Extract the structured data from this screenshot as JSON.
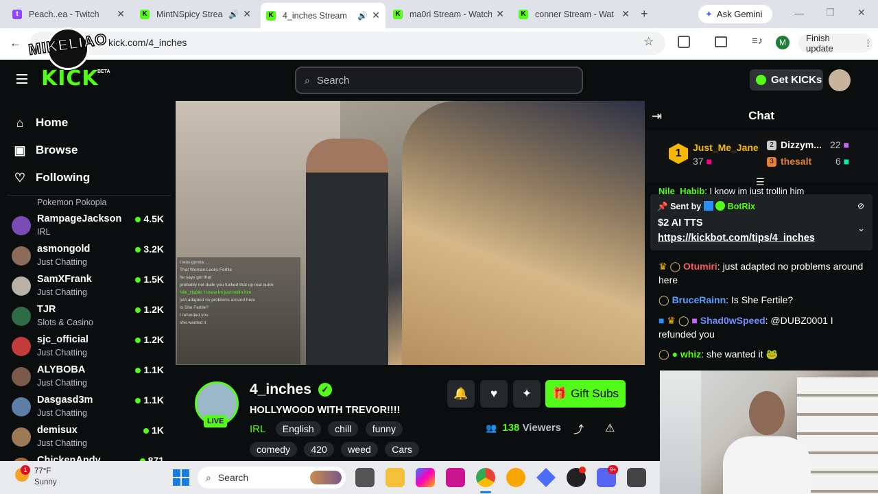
{
  "browser": {
    "tabs": [
      {
        "title": "Peach..ea - Twitch",
        "favicon": "twitch"
      },
      {
        "title": "MintNSpicy Strea",
        "favicon": "kick"
      },
      {
        "title": "4_inches Stream",
        "favicon": "kick"
      },
      {
        "title": "ma0ri Stream - Watch",
        "favicon": "kick"
      },
      {
        "title": "conner Stream - Wat",
        "favicon": "kick"
      }
    ],
    "ask_gemini": "Ask Gemini",
    "url": "kick.com/4_inches",
    "finish_update": "Finish update",
    "profile_initial": "M",
    "overlay_logo": "MIKELIAO"
  },
  "kick": {
    "logo": "KICK",
    "beta": "BETA",
    "search_placeholder": "Search",
    "get_kicks": "Get KICKs",
    "nav": [
      {
        "label": "Home",
        "icon": "home-icon"
      },
      {
        "label": "Browse",
        "icon": "browse-icon"
      },
      {
        "label": "Following",
        "icon": "heart-icon"
      }
    ],
    "cut_item": "Pokemon Pokopia",
    "channels": [
      {
        "name": "RampageJackson",
        "category": "IRL",
        "viewers": "4.5K",
        "color": "#7a4bb5"
      },
      {
        "name": "asmongold",
        "category": "Just Chatting",
        "viewers": "3.2K",
        "color": "#8c6b58"
      },
      {
        "name": "SamXFrank",
        "category": "Just Chatting",
        "viewers": "1.5K",
        "color": "#b9b1a8"
      },
      {
        "name": "TJR",
        "category": "Slots & Casino",
        "viewers": "1.2K",
        "color": "#2e6b46"
      },
      {
        "name": "sjc_official",
        "category": "Just Chatting",
        "viewers": "1.2K",
        "color": "#c43b3b"
      },
      {
        "name": "ALYBOBA",
        "category": "Just Chatting",
        "viewers": "1.1K",
        "color": "#7b5a4c"
      },
      {
        "name": "Dasgasd3m",
        "category": "Just Chatting",
        "viewers": "1.1K",
        "color": "#5d7fa6"
      },
      {
        "name": "demisux",
        "category": "Just Chatting",
        "viewers": "1K",
        "color": "#9c7a55"
      },
      {
        "name": "ChickenAndy",
        "category": "",
        "viewers": "871",
        "color": "#a56a3a"
      }
    ]
  },
  "stream": {
    "streamer": "4_inches",
    "title": "HOLLYWOOD WITH TREVOR!!!!",
    "category": "IRL",
    "tags": [
      "English",
      "chill",
      "funny",
      "comedy",
      "420",
      "weed",
      "Cars"
    ],
    "live_badge": "LIVE",
    "viewers": "138",
    "viewers_label": "Viewers",
    "gift_subs": "Gift Subs",
    "video_overlay_lines": [
      "I was gonna ...",
      "That Woman Looks Fertile",
      "he says got that",
      "probably not dude you fucked that up real quick",
      "Nile_Habib: I know im just trollin him",
      "just adapted no problems around here",
      "Is She Fertile?",
      "I refunded you",
      "she wanted it"
    ]
  },
  "chat": {
    "title": "Chat",
    "leaderboard": [
      {
        "rank": "1",
        "name": "Just_Me_Jane",
        "count": "37"
      },
      {
        "rank": "2",
        "name": "Dizzym...",
        "count": "22"
      },
      {
        "rank": "3",
        "name": "thesalt",
        "count": "6"
      }
    ],
    "partial_msg_user": "Nile_Habib",
    "partial_msg_text": ": I know im just trollin him",
    "pinned_sent_by": "Sent by",
    "pinned_user": "BotRix",
    "pinned_title": "$2 AI TTS",
    "pinned_link": "https://kickbot.com/tips/4_inches",
    "messages": [
      {
        "user": "Otumiri",
        "text": ": just adapted no problems around here",
        "color": "#ff5a5a"
      },
      {
        "user": "BruceRainn",
        "text": ": Is She Fertile?",
        "color": "#5a9cff"
      },
      {
        "user": "Shad0wSpeed",
        "text": ": @DUBZ0001 I refunded you",
        "color": "#6e8dff"
      },
      {
        "user": "whiz",
        "text": ": she wanted it",
        "color": "#53fc18"
      }
    ]
  },
  "taskbar": {
    "temp": "77°F",
    "weather": "Sunny",
    "search": "Search",
    "weather_badge": "1",
    "discord_badge": "9+"
  },
  "colors": {
    "kick_green": "#53fc18",
    "bg": "#0b0e0f"
  }
}
